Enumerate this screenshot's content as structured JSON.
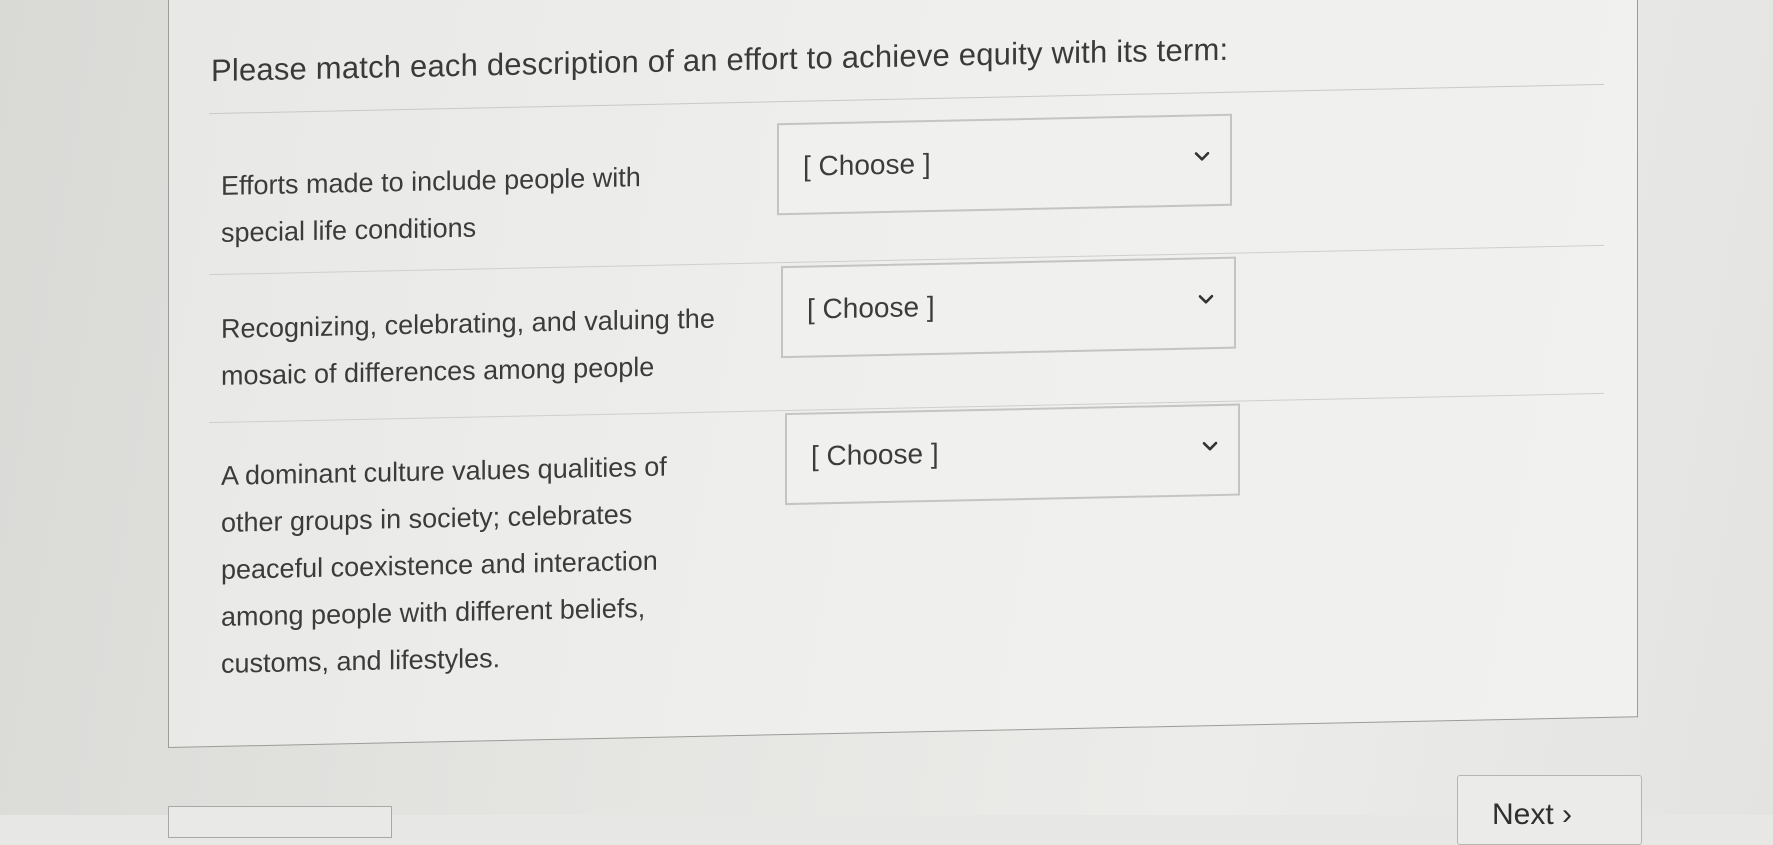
{
  "question": {
    "prompt": "Please match each description of an effort to achieve equity with its term:"
  },
  "rows": [
    {
      "description": "Efforts made to include people with special life conditions",
      "select_value": "[ Choose ]"
    },
    {
      "description": "Recognizing, celebrating, and valuing the mosaic of differences among people",
      "select_value": "[ Choose ]"
    },
    {
      "description": "A dominant culture values qualities of other groups in society; celebrates peaceful coexistence and interaction among people with different beliefs, customs, and lifestyles.",
      "select_value": "[ Choose ]"
    }
  ],
  "footer": {
    "next_label": "Next ›"
  },
  "icons": {
    "dropdown": "chevron-down-icon"
  },
  "colors": {
    "text": "#3b3b3b",
    "border": "#c4c4c2"
  }
}
